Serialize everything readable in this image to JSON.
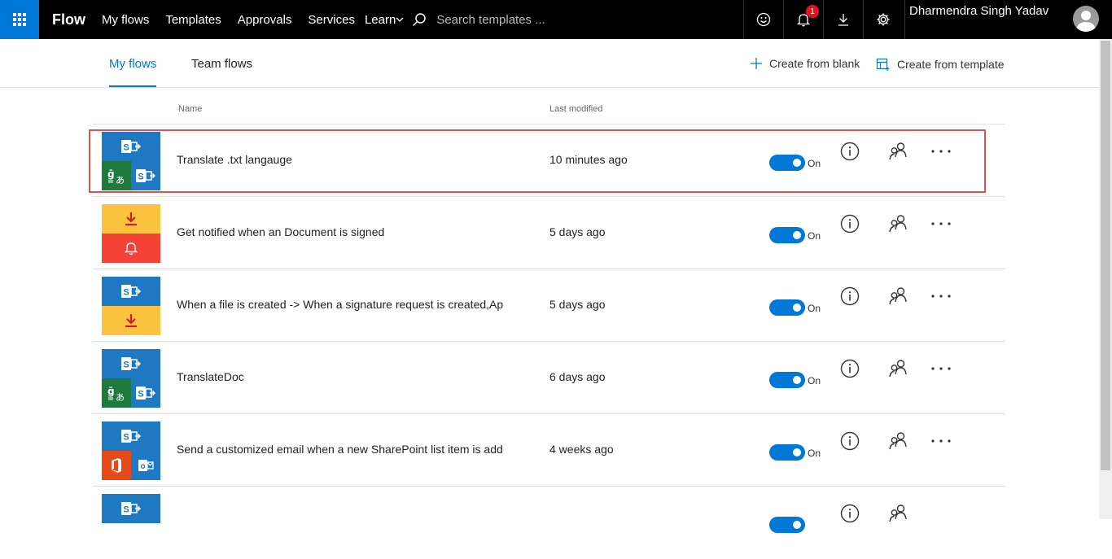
{
  "topbar": {
    "brand": "Flow",
    "nav": [
      "My flows",
      "Templates",
      "Approvals",
      "Services"
    ],
    "learn": "Learn",
    "search_placeholder": "Search templates ...",
    "notification_count": "1",
    "user_name": "Dharmendra Singh Yadav"
  },
  "subhead": {
    "tab_my_flows": "My flows",
    "tab_team_flows": "Team flows",
    "create_blank": "Create from blank",
    "create_template": "Create from template"
  },
  "columns": {
    "name": "Name",
    "last_modified": "Last modified"
  },
  "rows": [
    {
      "name": "Translate .txt langauge",
      "modified": "10 minutes ago",
      "status": "On",
      "icons": [
        "sharepoint-icon",
        "translator-icon",
        "sharepoint-icon"
      ]
    },
    {
      "name": "Get notified when an Document is signed",
      "modified": "5 days ago",
      "status": "On",
      "icons": [
        "download-icon",
        "notification-bell-icon"
      ]
    },
    {
      "name": "When a file is created -> When a signature request is created,Ap",
      "modified": "5 days ago",
      "status": "On",
      "icons": [
        "sharepoint-icon",
        "download-icon"
      ]
    },
    {
      "name": "TranslateDoc",
      "modified": "6 days ago",
      "status": "On",
      "icons": [
        "sharepoint-icon",
        "translator-icon",
        "sharepoint-icon"
      ]
    },
    {
      "name": "Send a customized email when a new SharePoint list item is add",
      "modified": "4 weeks ago",
      "status": "On",
      "icons": [
        "sharepoint-icon",
        "office-icon",
        "outlook-icon"
      ]
    },
    {
      "name": "",
      "modified": "",
      "status": "",
      "icons": [
        "sharepoint-icon"
      ]
    }
  ],
  "colors": {
    "accent": "#0078d7",
    "sharepoint": "#1e78c2",
    "translator": "#1e7a3c",
    "download_tile": "#fcc43e",
    "notification_tile": "#f44336",
    "office": "#e64a19",
    "highlight": "#d9534f"
  }
}
